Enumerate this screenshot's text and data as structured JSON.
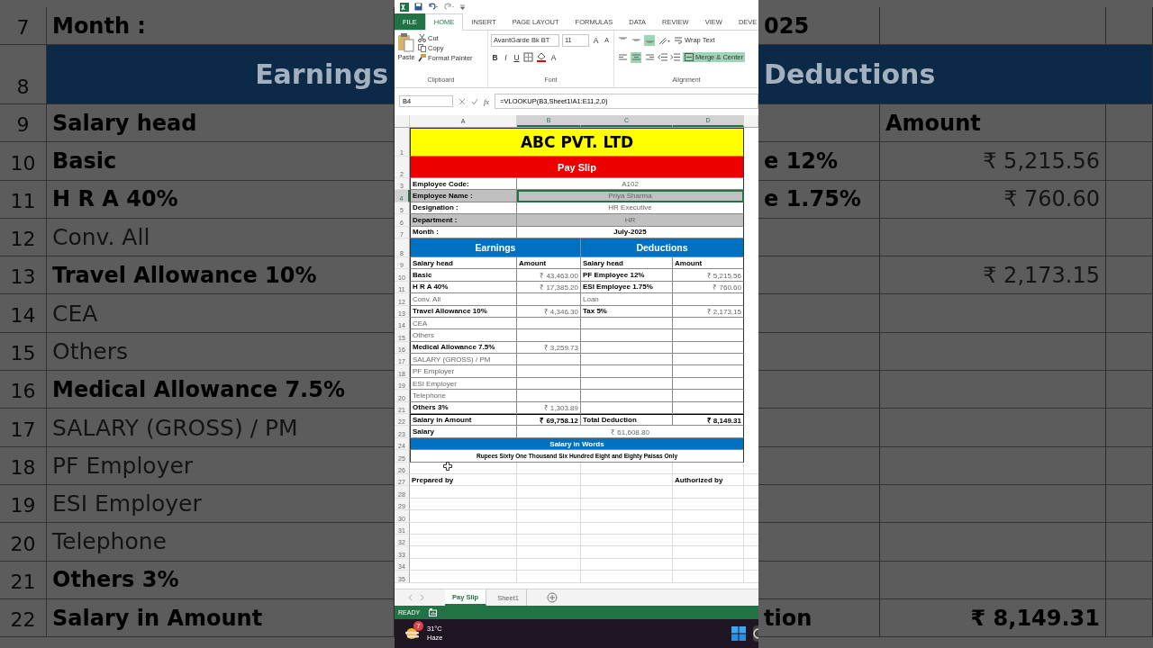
{
  "backdrop": {
    "rows": [
      {
        "number": "7",
        "kind": "cell",
        "column_a": {
          "text": "Month :",
          "bold": true
        },
        "column_c": {
          "text": "025",
          "bold": true
        }
      },
      {
        "number": "8",
        "kind": "band",
        "column_a": {
          "text": "Earnings",
          "bold": true
        },
        "column_c": {
          "text": "Deductions",
          "bold": true
        }
      },
      {
        "number": "9",
        "kind": "cell",
        "column_a": {
          "text": "Salary head",
          "bold": true
        },
        "column_d": {
          "text": "Amount",
          "bold": true
        }
      },
      {
        "number": "10",
        "kind": "cell",
        "column_a": {
          "text": "Basic",
          "bold": true
        },
        "column_c": {
          "text": "e 12%",
          "bold": true
        },
        "column_d": {
          "text": "₹ 5,215.56",
          "bold": false
        }
      },
      {
        "number": "11",
        "kind": "cell",
        "column_a": {
          "text": "H R A 40%",
          "bold": true
        },
        "column_c": {
          "text": "e 1.75%",
          "bold": true
        },
        "column_d": {
          "text": "₹ 760.60",
          "bold": false
        }
      },
      {
        "number": "12",
        "kind": "cell",
        "column_a": {
          "text": "Conv. All",
          "bold": false
        }
      },
      {
        "number": "13",
        "kind": "cell",
        "column_a": {
          "text": "Travel Allowance 10%",
          "bold": true
        },
        "column_d": {
          "text": "₹ 2,173.15",
          "bold": false
        }
      },
      {
        "number": "14",
        "kind": "cell",
        "column_a": {
          "text": "CEA",
          "bold": false
        }
      },
      {
        "number": "15",
        "kind": "cell",
        "column_a": {
          "text": "Others",
          "bold": false
        }
      },
      {
        "number": "16",
        "kind": "cell",
        "column_a": {
          "text": "Medical Allowance 7.5%",
          "bold": true
        }
      },
      {
        "number": "17",
        "kind": "cell",
        "column_a": {
          "text": "SALARY (GROSS) / PM",
          "bold": false
        }
      },
      {
        "number": "18",
        "kind": "cell",
        "column_a": {
          "text": "PF Employer",
          "bold": false
        }
      },
      {
        "number": "19",
        "kind": "cell",
        "column_a": {
          "text": "ESI Employer",
          "bold": false
        }
      },
      {
        "number": "20",
        "kind": "cell",
        "column_a": {
          "text": "Telephone",
          "bold": false
        }
      },
      {
        "number": "21",
        "kind": "cell",
        "column_a": {
          "text": "Others  3%",
          "bold": true
        }
      },
      {
        "number": "22",
        "kind": "cell",
        "column_a": {
          "text": "Salary in Amount",
          "bold": true
        },
        "column_c": {
          "text": "tion",
          "bold": true
        },
        "column_d": {
          "text": "₹ 8,149.31",
          "bold": true
        }
      }
    ]
  },
  "ribbon_tabs": [
    {
      "label": "FILE",
      "kind": "file",
      "selected": false
    },
    {
      "label": "HOME",
      "kind": "tab",
      "selected": true
    },
    {
      "label": "INSERT",
      "kind": "tab",
      "selected": false
    },
    {
      "label": "PAGE LAYOUT",
      "kind": "tab",
      "selected": false
    },
    {
      "label": "FORMULAS",
      "kind": "tab",
      "selected": false
    },
    {
      "label": "DATA",
      "kind": "tab",
      "selected": false
    },
    {
      "label": "REVIEW",
      "kind": "tab",
      "selected": false
    },
    {
      "label": "VIEW",
      "kind": "tab",
      "selected": false
    },
    {
      "label": "DEVE",
      "kind": "tab",
      "selected": false
    }
  ],
  "clipboard": {
    "paste": "Paste",
    "cut": "Cut",
    "copy": "Copy",
    "format_painter": "Format Painter",
    "label": "Clipboard"
  },
  "font": {
    "name": "AvantGarde Bk BT",
    "size": "11",
    "grow": "A",
    "shrink": "A",
    "bold": "B",
    "italic": "I",
    "underline": "U",
    "color_letter": "A",
    "label": "Font"
  },
  "alignment": {
    "vertical": [
      {
        "on": false
      },
      {
        "on": false
      },
      {
        "on": true
      }
    ],
    "horizontal": [
      {
        "on": false
      },
      {
        "on": true
      },
      {
        "on": false
      }
    ],
    "wrap_text": "Wrap Text",
    "merge_center": {
      "label": "Merge & Center",
      "on": true
    },
    "label": "Alignment"
  },
  "formula_bar": {
    "name_box": "B4",
    "function_label": "fx",
    "formula": "=VLOOKUP(B3,Sheet1!A1:E11,2,0)"
  },
  "sheet": {
    "columns": [
      {
        "label": "A",
        "selected": false
      },
      {
        "label": "B",
        "selected": true
      },
      {
        "label": "C",
        "selected": true
      },
      {
        "label": "D",
        "selected": true
      }
    ],
    "rows": [
      {
        "number": "1",
        "kind": "title",
        "selected": false,
        "cells": [
          {
            "text": "ABC PVT. LTD",
            "bold": true
          }
        ]
      },
      {
        "number": "2",
        "kind": "banner",
        "selected": false,
        "cells": [
          {
            "text": "Pay Slip",
            "bold": true
          }
        ]
      },
      {
        "number": "3",
        "kind": "field",
        "selected": false,
        "shaded": false,
        "cells": [
          {
            "text": "Employee Code:",
            "bold": true
          },
          {
            "text": "A102",
            "bold": false
          }
        ]
      },
      {
        "number": "4",
        "kind": "field",
        "selected": true,
        "shaded": true,
        "cells": [
          {
            "text": "Employee Name :",
            "bold": true
          },
          {
            "text": "Priya Sharma",
            "bold": false
          }
        ]
      },
      {
        "number": "5",
        "kind": "field",
        "selected": false,
        "shaded": false,
        "cells": [
          {
            "text": "Designation :",
            "bold": true
          },
          {
            "text": "HR Executive",
            "bold": false
          }
        ]
      },
      {
        "number": "6",
        "kind": "field",
        "selected": false,
        "shaded": true,
        "cells": [
          {
            "text": "Department :",
            "bold": true
          },
          {
            "text": "HR",
            "bold": false
          }
        ]
      },
      {
        "number": "7",
        "kind": "field",
        "selected": false,
        "shaded": false,
        "cells": [
          {
            "text": "Month :",
            "bold": true
          },
          {
            "text": "July-2025",
            "bold": true
          }
        ]
      },
      {
        "number": "8",
        "kind": "band",
        "selected": false,
        "cells": [
          {
            "text": "Earnings",
            "bold": true
          },
          {
            "text": "Deductions",
            "bold": true
          }
        ]
      },
      {
        "number": "9",
        "kind": "heading",
        "selected": false,
        "cells": [
          {
            "text": "Salary head",
            "bold": true
          },
          {
            "text": "Amount",
            "bold": true
          },
          {
            "text": "Salary head",
            "bold": true
          },
          {
            "text": "Amount",
            "bold": true
          }
        ]
      },
      {
        "number": "10",
        "kind": "table",
        "selected": false,
        "cells": [
          {
            "text": "Basic",
            "bold": true
          },
          {
            "text": "₹ 43,463.00",
            "bold": false
          },
          {
            "text": "PF Employee 12%",
            "bold": true
          },
          {
            "text": "₹ 5,215.56",
            "bold": false
          }
        ]
      },
      {
        "number": "11",
        "kind": "table",
        "selected": false,
        "cells": [
          {
            "text": "H R A 40%",
            "bold": true
          },
          {
            "text": "₹ 17,385.20",
            "bold": false
          },
          {
            "text": "ESI Employee 1.75%",
            "bold": true
          },
          {
            "text": "₹ 760.60",
            "bold": false
          }
        ]
      },
      {
        "number": "12",
        "kind": "table",
        "selected": false,
        "cells": [
          {
            "text": "Conv. All",
            "bold": false
          },
          null,
          {
            "text": "Loan",
            "bold": false
          },
          null
        ]
      },
      {
        "number": "13",
        "kind": "table",
        "selected": false,
        "cells": [
          {
            "text": "Travel Allowance 10%",
            "bold": true
          },
          {
            "text": "₹ 4,346.30",
            "bold": false
          },
          {
            "text": "Tax  5%",
            "bold": true
          },
          {
            "text": "₹ 2,173.15",
            "bold": false
          }
        ]
      },
      {
        "number": "14",
        "kind": "table",
        "selected": false,
        "cells": [
          {
            "text": "CEA",
            "bold": false
          },
          null,
          null,
          null
        ]
      },
      {
        "number": "15",
        "kind": "table",
        "selected": false,
        "cells": [
          {
            "text": "Others",
            "bold": false
          },
          null,
          null,
          null
        ]
      },
      {
        "number": "16",
        "kind": "table",
        "selected": false,
        "cells": [
          {
            "text": "Medical Allowance 7.5%",
            "bold": true
          },
          {
            "text": "₹ 3,259.73",
            "bold": false
          },
          null,
          null
        ]
      },
      {
        "number": "17",
        "kind": "table",
        "selected": false,
        "cells": [
          {
            "text": "SALARY (GROSS) / PM",
            "bold": false
          },
          null,
          null,
          null
        ]
      },
      {
        "number": "18",
        "kind": "table",
        "selected": false,
        "cells": [
          {
            "text": "PF Employer",
            "bold": false
          },
          null,
          null,
          null
        ]
      },
      {
        "number": "19",
        "kind": "table",
        "selected": false,
        "cells": [
          {
            "text": "ESI Employer",
            "bold": false
          },
          null,
          null,
          null
        ]
      },
      {
        "number": "20",
        "kind": "table",
        "selected": false,
        "cells": [
          {
            "text": "Telephone",
            "bold": false
          },
          null,
          null,
          null
        ]
      },
      {
        "number": "21",
        "kind": "table",
        "selected": false,
        "cells": [
          {
            "text": "Others  3%",
            "bold": true
          },
          {
            "text": "₹ 1,303.89",
            "bold": false
          },
          null,
          null
        ]
      },
      {
        "number": "22",
        "kind": "total",
        "selected": false,
        "cells": [
          {
            "text": "Salary in Amount",
            "bold": true
          },
          {
            "text": "₹ 69,758.12",
            "bold": true
          },
          {
            "text": "Total Deduction",
            "bold": true
          },
          {
            "text": "₹ 8,149.31",
            "bold": true
          }
        ]
      },
      {
        "number": "23",
        "kind": "field",
        "selected": false,
        "shaded": false,
        "cells": [
          {
            "text": "Salary",
            "bold": true
          },
          {
            "text": "₹ 61,608.80",
            "bold": false
          }
        ]
      },
      {
        "number": "24",
        "kind": "band",
        "selected": false,
        "cells": [
          {
            "text": "Salary in Words",
            "bold": true
          }
        ]
      },
      {
        "number": "25",
        "kind": "words",
        "selected": false,
        "cells": [
          {
            "text": "Rupees Sixty One Thousand  Six Hundred  Eight and Eighty Paisas Only",
            "bold": true
          }
        ]
      },
      {
        "number": "26",
        "kind": "blank",
        "selected": false,
        "cells": [
          null,
          null,
          null,
          null
        ]
      },
      {
        "number": "27",
        "kind": "signature",
        "selected": false,
        "cells": [
          {
            "text": "Prepared by",
            "bold": true
          },
          null,
          null,
          {
            "text": "Authorized by",
            "bold": true
          }
        ]
      },
      {
        "number": "28",
        "kind": "blank",
        "selected": false,
        "cells": [
          null,
          null,
          null,
          null
        ]
      },
      {
        "number": "29",
        "kind": "blank",
        "selected": false,
        "cells": [
          null,
          null,
          null,
          null
        ]
      },
      {
        "number": "30",
        "kind": "blank",
        "selected": false,
        "cells": [
          null,
          null,
          null,
          null
        ]
      },
      {
        "number": "31",
        "kind": "blank",
        "selected": false,
        "cells": [
          null,
          null,
          null,
          null
        ]
      },
      {
        "number": "32",
        "kind": "blank",
        "selected": false,
        "cells": [
          null,
          null,
          null,
          null
        ]
      },
      {
        "number": "33",
        "kind": "blank",
        "selected": false,
        "cells": [
          null,
          null,
          null,
          null
        ]
      },
      {
        "number": "34",
        "kind": "blank",
        "selected": false,
        "cells": [
          null,
          null,
          null,
          null
        ]
      },
      {
        "number": "35",
        "kind": "blank",
        "selected": false,
        "cells": [
          null,
          null,
          null,
          null
        ]
      }
    ]
  },
  "sheet_tabs": [
    {
      "label": "Pay Slip",
      "selected": true
    },
    {
      "label": "Sheet1",
      "selected": false
    }
  ],
  "status_bar": {
    "text": "READY"
  },
  "taskbar": {
    "badge": "7",
    "temperature": "31°C",
    "condition": "Haze"
  }
}
